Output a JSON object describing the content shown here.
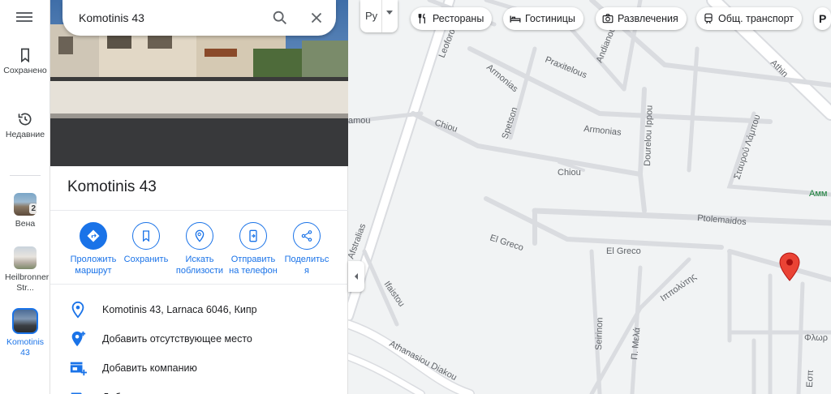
{
  "search": {
    "value": "Komotinis 43"
  },
  "rail": {
    "saved": "Сохранено",
    "recent": "Недавние",
    "history": [
      {
        "label": "Вена",
        "badge": "2"
      },
      {
        "label": "Heilbronner Str..."
      },
      {
        "label": "Komotinis 43"
      }
    ]
  },
  "place": {
    "title": "Komotinis 43",
    "actions": [
      {
        "icon": "directions-icon",
        "label": "Проложить\nмаршрут"
      },
      {
        "icon": "bookmark-icon",
        "label": "Сохранить"
      },
      {
        "icon": "nearby-icon",
        "label": "Искать\nпоблизости"
      },
      {
        "icon": "send-to-phone-icon",
        "label": "Отправить\nна телефон"
      },
      {
        "icon": "share-icon",
        "label": "Поделитьс\nя"
      }
    ],
    "info": [
      {
        "icon": "location-pin-icon",
        "text": "Komotinis 43, Larnaca 6046, Кипр"
      },
      {
        "icon": "add-place-icon",
        "text": "Добавить отсутствующее место"
      },
      {
        "icon": "add-business-icon",
        "text": "Добавить компанию"
      },
      {
        "icon": "label-icon",
        "text": "Доб"
      }
    ]
  },
  "map": {
    "layer_lang": "Py",
    "chips": [
      {
        "icon": "restaurant-icon",
        "label": "Рестораны"
      },
      {
        "icon": "hotel-icon",
        "label": "Гостиницы"
      },
      {
        "icon": "camera-icon",
        "label": "Развлечения"
      },
      {
        "icon": "transit-icon",
        "label": "Общ. транспорт"
      },
      {
        "icon": "parking-icon",
        "label": "P"
      }
    ],
    "streets": {
      "leoforos": "Leoforos",
      "athinon": "Athin",
      "armonias_top": "Armonias",
      "praxitelous": "Praxitelous",
      "andianou": "Andianou",
      "amou": "amou",
      "chiou_left": "Chiou",
      "spetson": "Spetson",
      "armonias_mid": "Armonias",
      "doureiou": "Dourelou Ippou",
      "stavros": "Σταυρού Λάμπου",
      "chiou_mid": "Chiou",
      "afstralias": "Afstralias",
      "ptolemaidos": "Ptolemaidos",
      "elgreco_diag": "El Greco",
      "elgreco": "El Greco",
      "ifaistou": "Ifaistou",
      "ippolytis": "Ιππολύτης",
      "seirinon": "Seirinon",
      "pmela": "Π. Μελά",
      "athanasiou": "Athanasiou Diakou",
      "flo": "Φλωρ",
      "esp": "Εσπ"
    },
    "poi": "Амм"
  },
  "colors": {
    "accent": "#1a73e8",
    "pin": "#ea4335",
    "road": "#dadce0"
  }
}
